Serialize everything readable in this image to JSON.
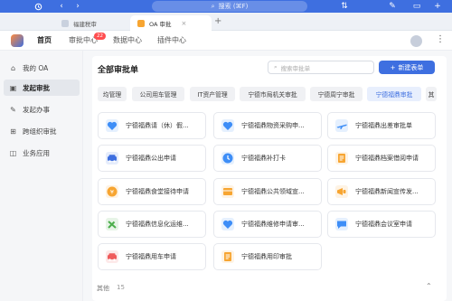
{
  "topbar": {
    "search_placeholder": "搜索 (⌘F)",
    "nav_icons": [
      "history-icon",
      "back-icon",
      "forward-icon"
    ],
    "right_icons": [
      "signal-icon",
      "status-icon",
      "wand-icon",
      "screen-icon",
      "add-icon"
    ]
  },
  "tabs": [
    {
      "label": "福建税审",
      "active": false
    },
    {
      "label": "OA 审批",
      "active": true
    }
  ],
  "header": {
    "menu": [
      "首页",
      "审批中心",
      "数据中心",
      "插件中心"
    ],
    "badge": "22"
  },
  "sidebar": {
    "items": [
      {
        "label": "我的 OA",
        "icon": "home-icon"
      },
      {
        "label": "发起审批",
        "icon": "stamp-icon",
        "active": true
      },
      {
        "label": "发起办事",
        "icon": "edit-icon"
      },
      {
        "label": "跨组织审批",
        "icon": "org-icon"
      },
      {
        "label": "业务应用",
        "icon": "apps-icon"
      }
    ]
  },
  "main": {
    "title": "全部审批单",
    "search_placeholder": "搜索审批单",
    "new_button": "新建表单",
    "categories": [
      "均管理",
      "公司用车管理",
      "IT资产管理",
      "宁德市局机关审批",
      "宁德周宁审批",
      "宁德福鼎审批",
      "其"
    ],
    "active_category": 5,
    "forms": [
      {
        "label": "宁德福鼎请（休）假...",
        "icon": "heart-icon",
        "color": "#3e8ef7"
      },
      {
        "label": "宁德福鼎物资采购申...",
        "icon": "heart-icon",
        "color": "#3e8ef7"
      },
      {
        "label": "宁德福鼎出差审批单",
        "icon": "plane-icon",
        "color": "#3e8ef7"
      },
      {
        "label": "宁德福鼎公出申请",
        "icon": "car-icon",
        "color": "#3e6fe0"
      },
      {
        "label": "宁德福鼎补打卡",
        "icon": "clock-icon",
        "color": "#3e8ef7"
      },
      {
        "label": "宁德福鼎档案借阅申请",
        "icon": "document-icon",
        "color": "#f7a531"
      },
      {
        "label": "宁德福鼎食堂接待申请",
        "icon": "coin-icon",
        "color": "#f7a531"
      },
      {
        "label": "宁德福鼎公共领域宣...",
        "icon": "box-icon",
        "color": "#f7a531"
      },
      {
        "label": "宁德福鼎新闻宣传发...",
        "icon": "megaphone-icon",
        "color": "#f7a531"
      },
      {
        "label": "宁德福鼎信息化运维...",
        "icon": "tools-icon",
        "color": "#4cae4c"
      },
      {
        "label": "宁德福鼎维修申请审...",
        "icon": "heart-icon",
        "color": "#3e8ef7"
      },
      {
        "label": "宁德福鼎会议室申请",
        "icon": "chat-icon",
        "color": "#3e8ef7"
      },
      {
        "label": "宁德福鼎用车申请",
        "icon": "car-icon",
        "color": "#ef5b5b"
      },
      {
        "label": "宁德福鼎用印审批",
        "icon": "document-icon",
        "color": "#f7a531"
      }
    ],
    "other_label": "其他",
    "other_count": "15"
  }
}
